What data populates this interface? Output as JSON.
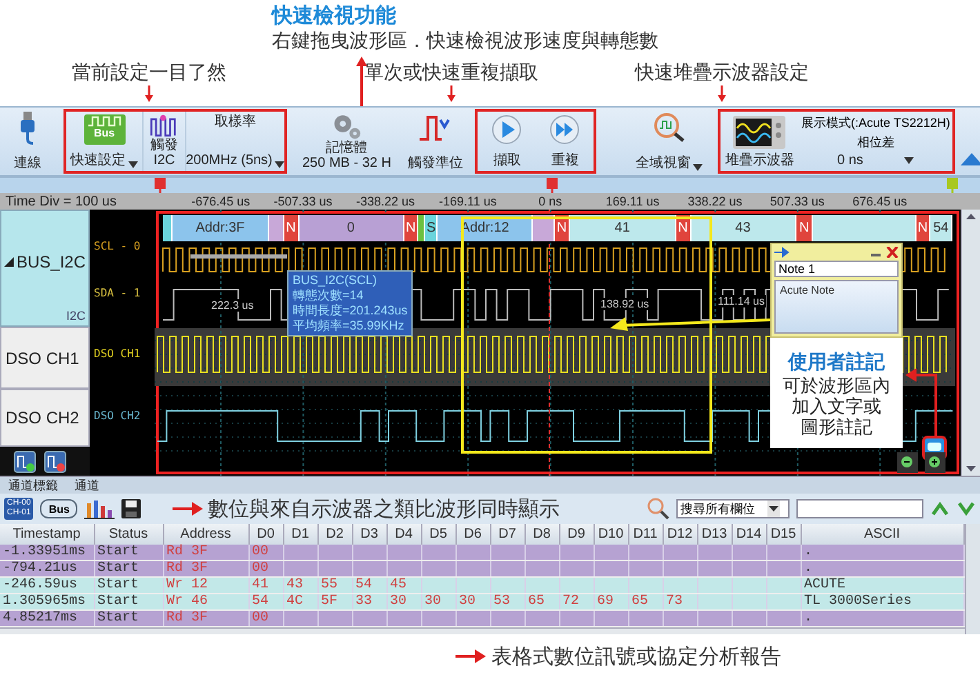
{
  "annotations": {
    "feature_title": "快速檢視功能",
    "feature_desc": "右鍵拖曳波形區．快速檢視波形速度與轉態數",
    "callouts": [
      "當前設定一目了然",
      "單次或快速重複擷取",
      "快速堆疊示波器設定"
    ],
    "note_title": "使用者註記",
    "note_lines": [
      "可於波形區內",
      "加入文字或",
      "圖形註記"
    ],
    "waveform_caption": "數位與來自示波器之類比波形同時顯示",
    "table_caption": "表格式數位訊號或協定分析報告"
  },
  "toolbar": {
    "connect": "連線",
    "quick_setup": {
      "badge": "Bus",
      "label": "快速設定"
    },
    "trigger": {
      "label": "觸發",
      "value": "I2C"
    },
    "sample_rate": {
      "label": "取樣率",
      "value": "200MHz (5ns)"
    },
    "memory": {
      "label": "記憶體",
      "value": "250 MB - 32 H"
    },
    "trigger_level": "觸發準位",
    "capture": "擷取",
    "repeat": "重複",
    "global_view": "全域視窗",
    "stack_scope": "堆疊示波器",
    "display_mode": "展示模式(:Acute TS2212H)",
    "phase": {
      "label": "相位差",
      "value": "0 ns"
    }
  },
  "ruler": {
    "time_div": "Time Div = 100 us",
    "ticks": [
      "-676.45 us",
      "-507.33 us",
      "-338.22 us",
      "-169.11 us",
      "0 ns",
      "169.11 us",
      "338.22 us",
      "507.33 us",
      "676.45 us"
    ]
  },
  "channels": [
    {
      "kind": "bus",
      "name": "BUS_I2C",
      "expanded": true,
      "protocol": "I2C",
      "lines": [
        "SCL - 0",
        "SDA - 1"
      ]
    },
    {
      "kind": "analog",
      "name": "DSO CH1",
      "signal": "DSO CH1"
    },
    {
      "kind": "analog",
      "name": "DSO CH2",
      "signal": "DSO CH2"
    }
  ],
  "decode": [
    {
      "kind": "start"
    },
    {
      "kind": "address",
      "text": "Addr:3F"
    },
    {
      "kind": "gap"
    },
    {
      "kind": "nack",
      "text": "N"
    },
    {
      "kind": "read_data",
      "text": "0"
    },
    {
      "kind": "nack",
      "text": "N"
    },
    {
      "kind": "ack"
    },
    {
      "kind": "start",
      "text": "S"
    },
    {
      "kind": "address",
      "text": "Addr:12"
    },
    {
      "kind": "gap"
    },
    {
      "kind": "nack",
      "text": "N"
    },
    {
      "kind": "write_data",
      "text": "41"
    },
    {
      "kind": "nack",
      "text": "N"
    },
    {
      "kind": "write_data",
      "text": "43"
    },
    {
      "kind": "nack",
      "text": "N"
    },
    {
      "kind": "write_data"
    },
    {
      "kind": "nack",
      "text": "N"
    },
    {
      "kind": "write_data",
      "text": "54"
    }
  ],
  "measurements": [
    "222.3 us",
    "138.92 us",
    "111.14 us"
  ],
  "tooltip": {
    "title": "BUS_I2C(SCL)",
    "lines": [
      "轉態次數=14",
      "時間長度=201.243us",
      "平均頻率=35.99KHz"
    ]
  },
  "note": {
    "title": "Note 1",
    "body": "Acute Note"
  },
  "bottom_tabs": [
    "通道標籤",
    "通道"
  ],
  "panel_toolbar": {
    "channel_icon": [
      "CH-00",
      "CH-01"
    ],
    "bus_icon": "Bus",
    "search_scope": "搜尋所有欄位"
  },
  "table": {
    "columns": [
      "Timestamp",
      "Status",
      "Address",
      "D0",
      "D1",
      "D2",
      "D3",
      "D4",
      "D5",
      "D6",
      "D7",
      "D8",
      "D9",
      "D10",
      "D11",
      "D12",
      "D13",
      "D14",
      "D15",
      "ASCII"
    ],
    "rows": [
      {
        "kind": "read",
        "timestamp": "-1.33951ms",
        "status": "Start",
        "address": "Rd 3F",
        "data": [
          "00"
        ],
        "ascii": "."
      },
      {
        "kind": "read",
        "timestamp": "-794.21us",
        "status": "Start",
        "address": "Rd 3F",
        "data": [
          "00"
        ],
        "ascii": "."
      },
      {
        "kind": "write",
        "timestamp": "-246.59us",
        "status": "Start",
        "address": "Wr 12",
        "data": [
          "41",
          "43",
          "55",
          "54",
          "45"
        ],
        "ascii": "ACUTE"
      },
      {
        "kind": "write",
        "timestamp": "1.305965ms",
        "status": "Start",
        "address": "Wr 46",
        "data": [
          "54",
          "4C",
          "5F",
          "33",
          "30",
          "30",
          "30",
          "53",
          "65",
          "72",
          "69",
          "65",
          "73"
        ],
        "ascii": "TL 3000Series"
      },
      {
        "kind": "read",
        "timestamp": "4.85217ms",
        "status": "Start",
        "address": "Rd 3F",
        "data": [
          "00"
        ],
        "ascii": "."
      }
    ]
  }
}
